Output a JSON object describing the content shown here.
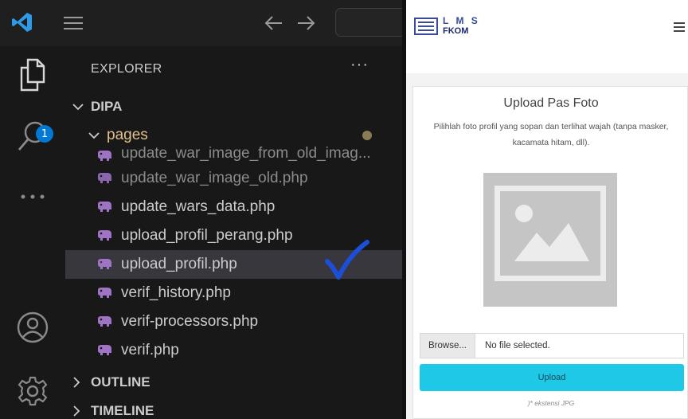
{
  "explorer": {
    "title": "EXPLORER",
    "more_label": "···",
    "badge_count": "1",
    "root_folder": "DIPA",
    "subfolder": "pages",
    "files": [
      "update_war_image_from_old_imag...",
      "update_war_image_old.php",
      "update_wars_data.php",
      "upload_profil_perang.php",
      "upload_profil.php",
      "verif_history.php",
      "verif-processors.php",
      "verif.php"
    ],
    "selected_file": "upload_profil.php",
    "sections": [
      "OUTLINE",
      "TIMELINE"
    ]
  },
  "browser": {
    "logo_line1": "L M S",
    "logo_line2": "FKOM",
    "upload_title": "Upload Pas Foto",
    "upload_description": "Pilihlah foto profil yang sopan dan terlihat wajah (tanpa masker, kacamata hitam, dll).",
    "browse_label": "Browse...",
    "file_status": "No file selected.",
    "upload_button": "Upload",
    "extension_note": ")* ekstensi JPG"
  },
  "colors": {
    "vscode_blue": "#0078d4",
    "folder_color": "#e2c08d",
    "php_icon": "#a074c4",
    "upload_button": "#1ec8e6",
    "check_mark": "#1d4ed8"
  },
  "icons": [
    "vscode-logo-icon",
    "menu-icon",
    "arrow-left-icon",
    "arrow-right-icon",
    "files-icon",
    "search-icon",
    "more-icon",
    "account-icon",
    "settings-gear-icon",
    "chevron-down-icon",
    "chevron-right-icon",
    "php-elephant-icon",
    "hamburger-menu-icon",
    "image-placeholder-icon",
    "checkmark-icon"
  ]
}
